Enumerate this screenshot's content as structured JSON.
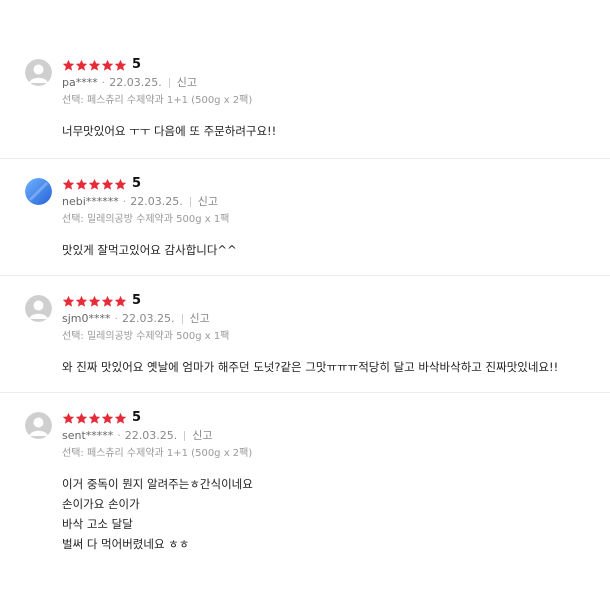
{
  "reviews": [
    {
      "avatar": "default-profile-icon",
      "rating": 5,
      "score": "5",
      "user": "pa****",
      "date": "22.03.25.",
      "report": "신고",
      "option": "선택: 페스츄리 수제약과 1+1 (500g x 2팩)",
      "content": [
        "너무맛있어요 ㅜㅜ 다음에 또 주문하려구요!!"
      ]
    },
    {
      "avatar": "blue-profile-icon",
      "rating": 5,
      "score": "5",
      "user": "nebi******",
      "date": "22.03.25.",
      "report": "신고",
      "option": "선택: 밀레의공방 수제약과 500g x 1팩",
      "content": [
        "맛있게 잘먹고있어요 감사합니다^^"
      ]
    },
    {
      "avatar": "default-profile-icon",
      "rating": 5,
      "score": "5",
      "user": "sjm0****",
      "date": "22.03.25.",
      "report": "신고",
      "option": "선택: 밀레의공방 수제약과 500g x 1팩",
      "content": [
        "와 진짜 맛있어요 옛날에 엄마가 해주던 도넛?같은 그맛ㅠㅠㅠ적당히 달고 바삭바삭하고 진짜맛있네요!!"
      ]
    },
    {
      "avatar": "default-profile-icon",
      "rating": 5,
      "score": "5",
      "user": "sent*****",
      "date": "22.03.25.",
      "report": "신고",
      "option": "선택: 페스츄리 수제약과 1+1 (500g x 2팩)",
      "content": [
        "이거 중독이 뭔지 알려주는ㅎ간식이네요",
        "손이가요 손이가",
        "바삭 고소 달달",
        "벌써 다 먹어버렸네요 ㅎㅎ"
      ]
    }
  ],
  "colors": {
    "star": "#e52d3a",
    "blue_avatar": "#3b82f0",
    "grey_avatar": "#c9c9c9"
  }
}
